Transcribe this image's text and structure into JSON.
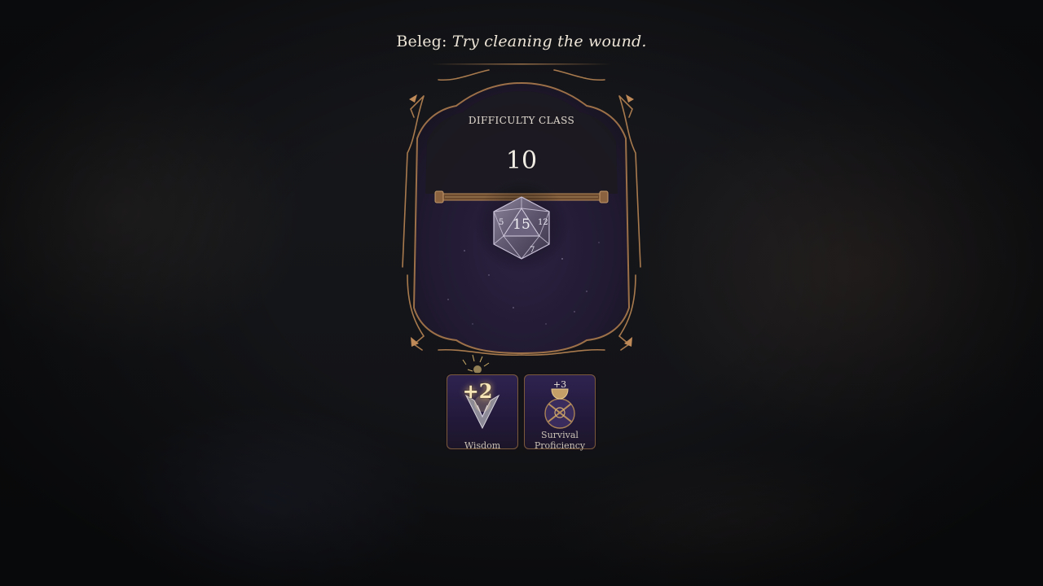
{
  "dialogue": {
    "speaker": "Beleg:",
    "line": "Try cleaning the wound."
  },
  "check": {
    "dc_label": "DIFFICULTY CLASS",
    "dc_value": "10",
    "die_type": "d20",
    "die_face": "15"
  },
  "bonuses": [
    {
      "name": "Wisdom",
      "value": "+2",
      "icon": "wisdom-emblem-icon"
    },
    {
      "name": "Survival Proficiency",
      "value": "+3",
      "icon": "survival-emblem-icon"
    }
  ],
  "colors": {
    "frame_bronze": "#a87a4e",
    "panel_purple": "#2a2040",
    "text_cream": "#ece4d6",
    "bonus_gold": "#f6e6b8"
  }
}
